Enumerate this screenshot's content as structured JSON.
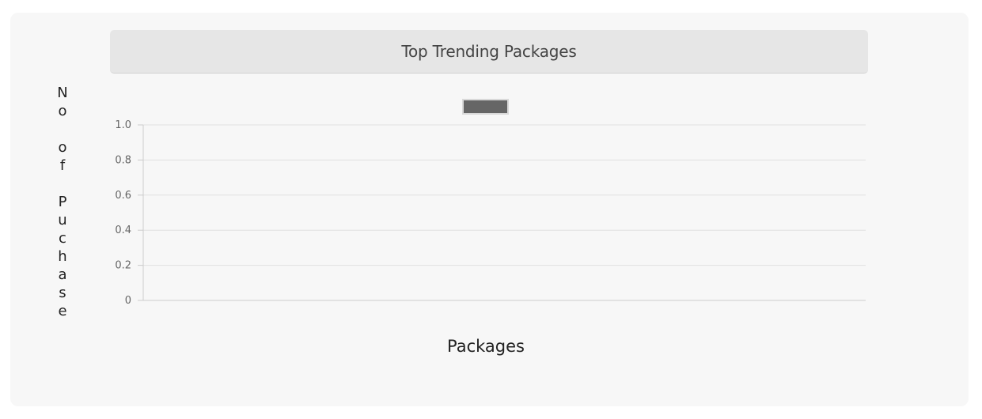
{
  "chart_data": {
    "type": "bar",
    "title": "Top Trending Packages",
    "xlabel": "Packages",
    "ylabel": "No of Puchase",
    "categories": [],
    "series": [
      {
        "values": []
      }
    ],
    "ylim": [
      0,
      1.0
    ],
    "yticks": [
      "1.0",
      "0.8",
      "0.6",
      "0.4",
      "0.2",
      "0"
    ],
    "grid": true,
    "legend_position": "top",
    "colors": {
      "legend_swatch": "#666666",
      "gridline": "#e0e0e0",
      "axis": "#cccccc",
      "panel_background": "#f7f7f7",
      "title_background": "#e6e6e6"
    }
  }
}
